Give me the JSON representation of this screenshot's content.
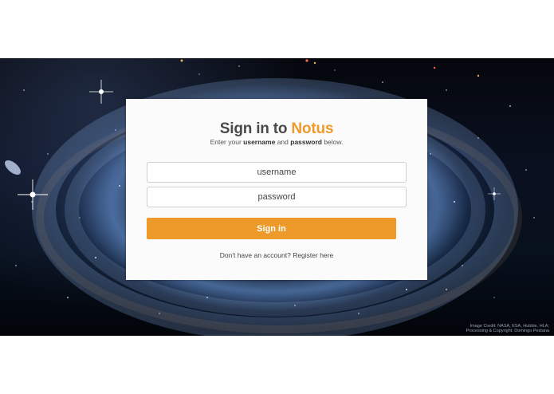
{
  "background": {
    "image_credit_line1": "Image Credit: NASA, ESA, Hubble, HLA;",
    "image_credit_line2": "Processing & Copyright: Domingo Pestana"
  },
  "login": {
    "title_prefix": "Sign in to",
    "title_brand": "Notus",
    "subtitle_part1": "Enter your",
    "subtitle_username": "username",
    "subtitle_part2": "and",
    "subtitle_password": "password",
    "subtitle_part3": "below.",
    "username_placeholder": "username",
    "password_placeholder": "password",
    "signin_label": "Sign in",
    "register_prompt": "Don't have an account?",
    "register_link": "Register here"
  },
  "colors": {
    "accent": "#ed9a2a",
    "title_text": "#4a4a4a",
    "card_bg": "#fbfbfb"
  }
}
